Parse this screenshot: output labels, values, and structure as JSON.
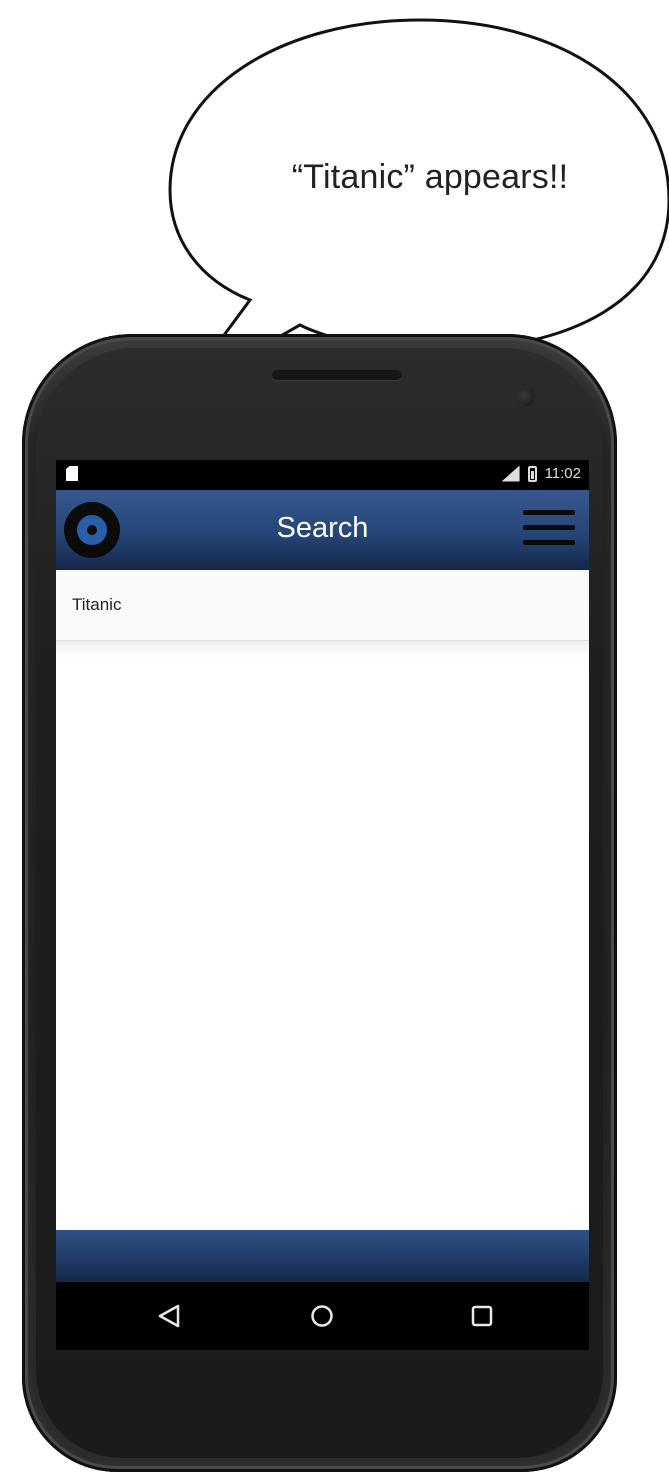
{
  "callout": {
    "text": "“Titanic” appears!!"
  },
  "status_bar": {
    "time": "11:02",
    "icons": [
      "sd-card-icon",
      "signal-icon",
      "battery-icon"
    ]
  },
  "app_bar": {
    "title": "Search",
    "logo_icon": "vinyl-record-icon",
    "menu_icon": "hamburger-menu-icon",
    "color": "#2b4b7c"
  },
  "results": {
    "items": [
      {
        "label": "Titanic"
      }
    ]
  },
  "nav_bar": {
    "buttons": [
      "back-icon",
      "home-icon",
      "recents-icon"
    ]
  }
}
